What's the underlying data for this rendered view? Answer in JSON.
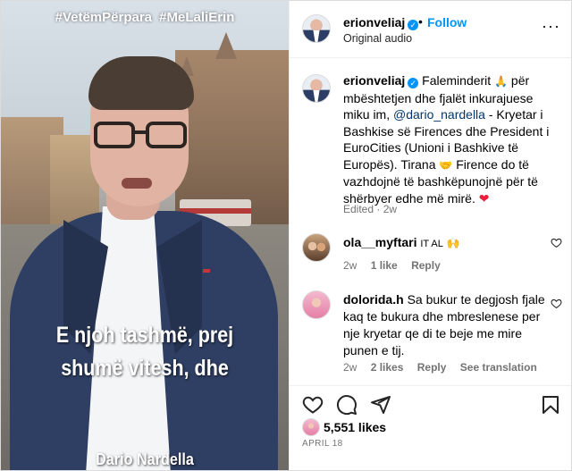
{
  "video": {
    "hashtags": "#VetëmPërpara  #MeLaliErin",
    "caption_line1": "E njoh tashmë, prej",
    "caption_line2": "shumë vitesh, dhe",
    "name_tag": "Dario Nardella"
  },
  "header": {
    "username": "erionveliaj",
    "verified_glyph": "✓",
    "separator": "•",
    "follow_label": "Follow",
    "audio_label": "Original audio",
    "more_glyph": "···"
  },
  "post": {
    "username": "erionveliaj",
    "verified_glyph": "✓",
    "text_part1": "Faleminderit",
    "emoji_pray": "🙏",
    "text_part2": "për mbështetjen dhe fjalët inkurajuese miku im,",
    "mention": "@dario_nardella",
    "text_part3": "- Kryetar i Bashkise së Firences dhe President i EuroCities (Unioni i Bashkive të Europës). Tirana",
    "emoji_handshake": "🤝",
    "text_part4": "Firence do të vazhdojnë të bashkëpunojnë për të shërbyer edhe më mirë.",
    "emoji_heart": "❤",
    "edited_label": "Edited",
    "edited_time": "2w"
  },
  "comments": [
    {
      "username": "ola__myftari",
      "text": "IT AL",
      "emoji": "🙌",
      "time": "2w",
      "likes": "1 like",
      "reply": "Reply"
    },
    {
      "username": "dolorida.h",
      "text": "Sa bukur te degjosh fjale kaq te bukura dhe mbreslenese per nje kryetar qe di te beje me mire punen e tij.",
      "time": "2w",
      "likes": "2 likes",
      "reply": "Reply",
      "translate": "See translation"
    }
  ],
  "actions": {
    "likes_count": "5,551 likes",
    "date": "APRIL 18"
  },
  "icons": {
    "like": "heart-icon",
    "comment": "comment-icon",
    "share": "share-icon",
    "save": "bookmark-icon",
    "comment_like": "heart-outline-icon"
  },
  "colors": {
    "link_blue": "#0095f6",
    "mention": "#00376b",
    "secondary": "#737373",
    "heart_red": "#ed1c3a"
  }
}
